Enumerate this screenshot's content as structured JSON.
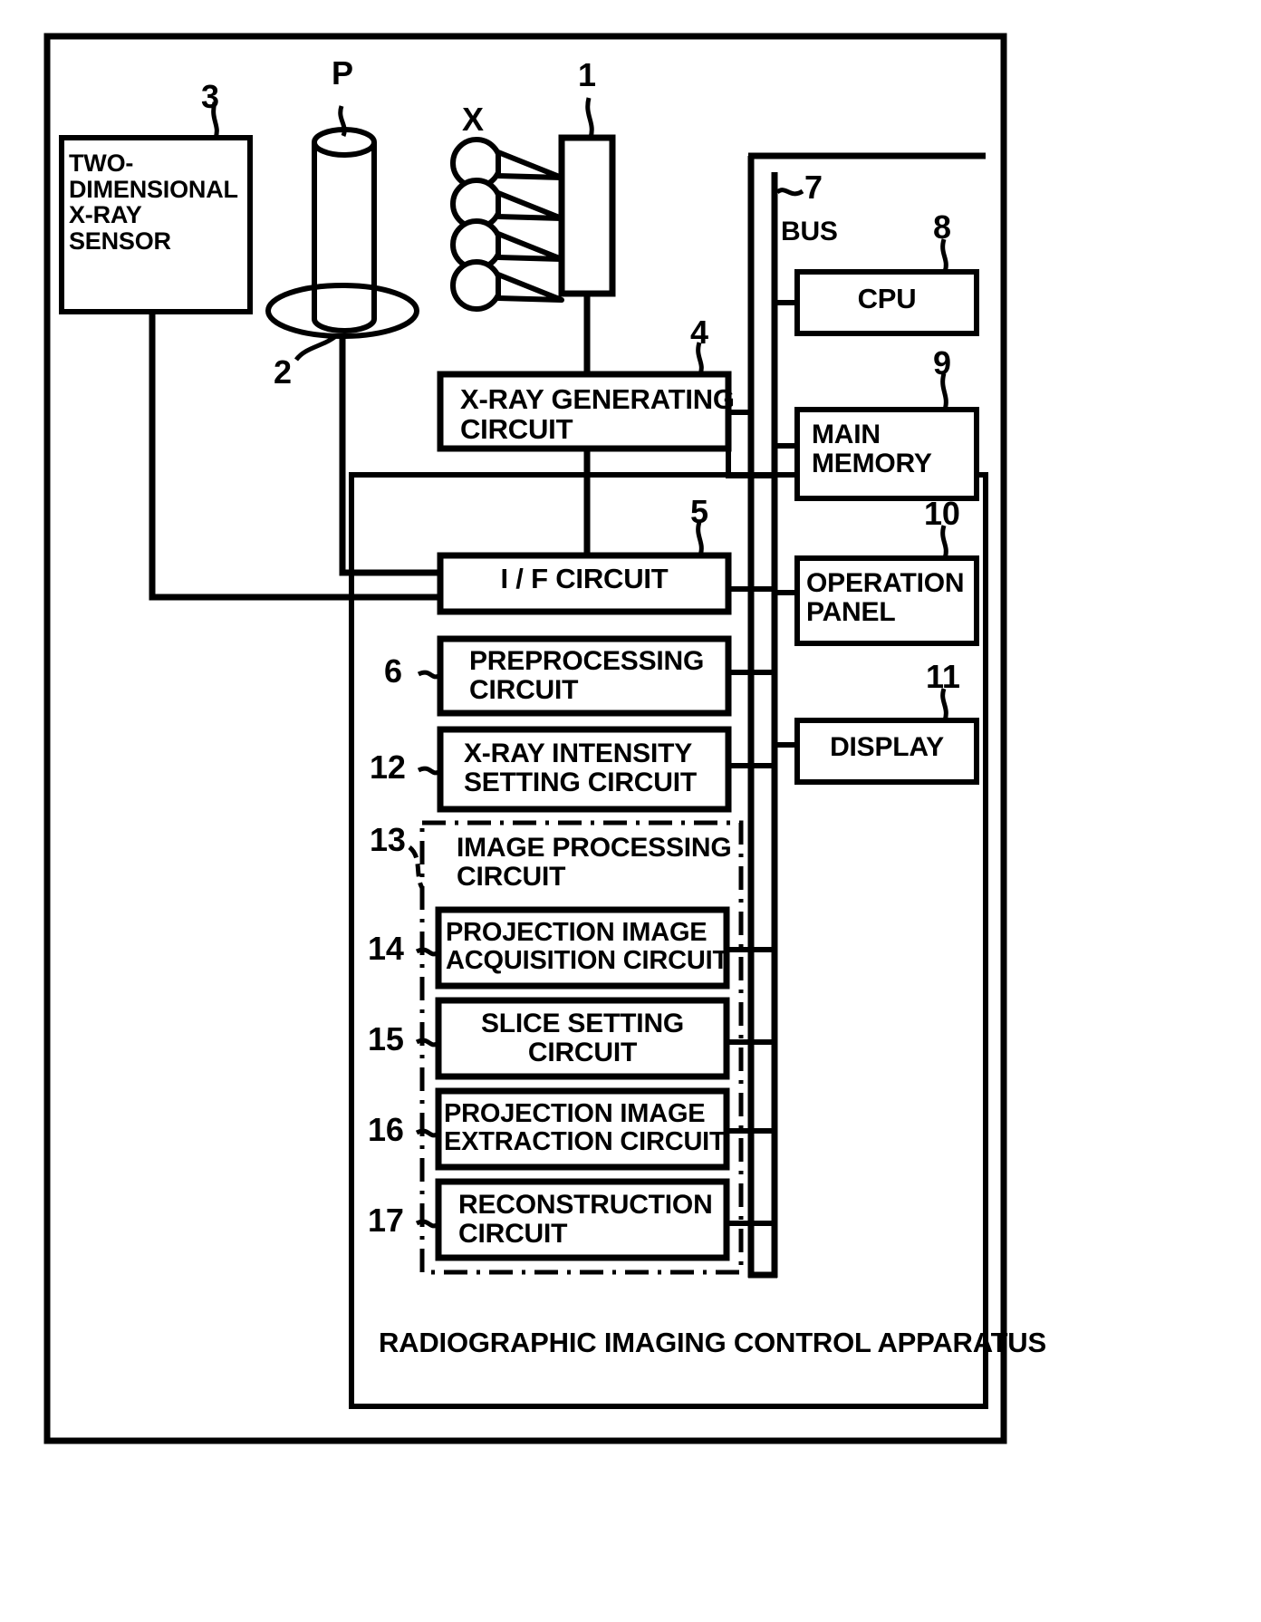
{
  "figure": {
    "kind": "patent-block-diagram",
    "apparatus_label": "RADIOGRAPHIC IMAGING CONTROL APPARATUS",
    "bus_label": "BUS"
  },
  "reference_numerals": {
    "xray_tube": "1",
    "turntable": "2",
    "sensor": "3",
    "xray_generating": "4",
    "if_circuit": "5",
    "preprocessing": "6",
    "bus": "7",
    "cpu": "8",
    "main_memory": "9",
    "operation_panel": "10",
    "display": "11",
    "xray_intensity": "12",
    "image_processing": "13",
    "projection_acquisition": "14",
    "slice_setting": "15",
    "projection_extraction": "16",
    "reconstruction": "17",
    "subject": "P",
    "xray_beam": "X"
  },
  "blocks": {
    "sensor": "TWO-\nDIMENSIONAL\nX-RAY\nSENSOR",
    "xray_generating": "X-RAY GENERATING\nCIRCUIT",
    "if_circuit": "I / F CIRCUIT",
    "preprocessing": "PREPROCESSING\nCIRCUIT",
    "xray_intensity": "X-RAY INTENSITY\nSETTING CIRCUIT",
    "image_processing": "IMAGE PROCESSING\nCIRCUIT",
    "projection_acquisition": "PROJECTION IMAGE\nACQUISITION CIRCUIT",
    "slice_setting": "SLICE SETTING\nCIRCUIT",
    "projection_extraction": "PROJECTION IMAGE\nEXTRACTION CIRCUIT",
    "reconstruction": "RECONSTRUCTION\nCIRCUIT",
    "cpu": "CPU",
    "main_memory": "MAIN\nMEMORY",
    "operation_panel": "OPERATION\nPANEL",
    "display": "DISPLAY"
  },
  "colors": {
    "ink": "#000000",
    "paper": "#ffffff"
  }
}
